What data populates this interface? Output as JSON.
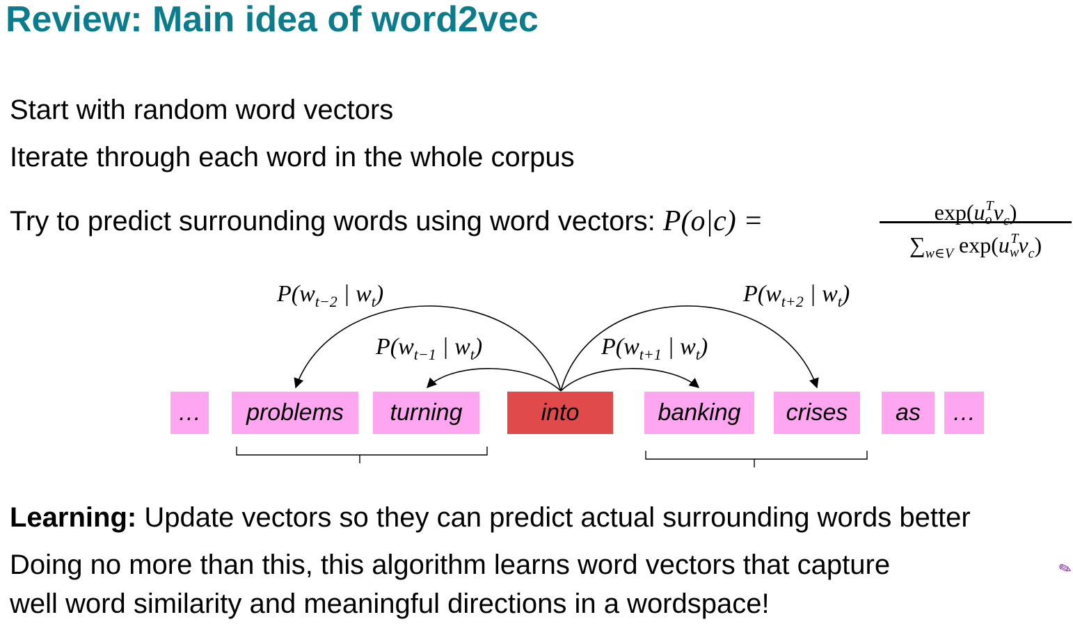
{
  "slide": {
    "title": "Review: Main idea of word2vec",
    "bullet1": "Start with random word vectors",
    "bullet2": "Iterate through each word in the whole corpus",
    "bullet3_text": "Try to predict surrounding words using word vectors: ",
    "bullet3_math": "P(o|c) =",
    "formula_numerator": "exp(u_o^T v_c)",
    "formula_denominator": "Σ_{w∈V} exp(u_w^T v_c)",
    "learning_label": "Learning:",
    "learning_text": " Update vectors so they can predict actual surrounding words better",
    "closing_line1": "Doing no more than this, this algorithm learns word vectors that capture",
    "closing_line2": "well word similarity and meaningful directions in a wordspace!"
  },
  "diagram": {
    "words": [
      "…",
      "problems",
      "turning",
      "into",
      "banking",
      "crises",
      "as",
      "…"
    ],
    "center_word": "into",
    "labels": {
      "p_minus2": "P(w_{t−2} | w_t)",
      "p_minus1": "P(w_{t−1} | w_t)",
      "p_plus1": "P(w_{t+1} | w_t)",
      "p_plus2": "P(w_{t+2} | w_t)"
    }
  },
  "colors": {
    "title": "#0b7c8c",
    "context_word": "#ffa6f0",
    "center_word": "#e14a4a"
  }
}
